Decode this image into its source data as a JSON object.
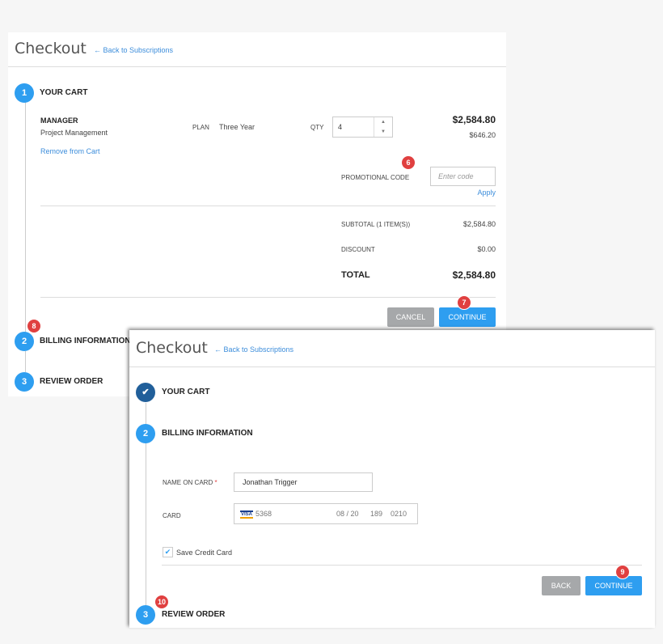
{
  "panel1": {
    "title": "Checkout",
    "back_link": "← Back to Subscriptions",
    "steps": [
      {
        "num": "1",
        "label": "YOUR CART"
      },
      {
        "num": "2",
        "label": "BILLING INFORMATION"
      },
      {
        "num": "3",
        "label": "REVIEW ORDER"
      }
    ],
    "item": {
      "name": "MANAGER",
      "subtitle": "Project Management",
      "remove": "Remove from Cart",
      "plan_label": "PLAN",
      "plan_value": "Three Year",
      "qty_label": "QTY",
      "qty_value": "4",
      "price": "$2,584.80",
      "unit_price": "$646.20"
    },
    "promo": {
      "label": "PROMOTIONAL CODE",
      "placeholder": "Enter code",
      "apply": "Apply"
    },
    "summary": {
      "subtotal_label": "SUBTOTAL (1 ITEM(S))",
      "subtotal_value": "$2,584.80",
      "discount_label": "DISCOUNT",
      "discount_value": "$0.00",
      "total_label": "TOTAL",
      "total_value": "$2,584.80"
    },
    "buttons": {
      "cancel": "CANCEL",
      "continue": "CONTINUE"
    }
  },
  "panel2": {
    "title": "Checkout",
    "back_link": "← Back to Subscriptions",
    "steps": [
      {
        "num": "✔",
        "label": "YOUR CART"
      },
      {
        "num": "2",
        "label": "BILLING INFORMATION"
      },
      {
        "num": "3",
        "label": "REVIEW ORDER"
      }
    ],
    "name_label": "NAME ON CARD",
    "required_mark": "*",
    "name_value": "Jonathan Trigger",
    "card_label": "CARD",
    "card": {
      "brand": "VISA",
      "number": "5368",
      "expiry": "08 / 20",
      "cvc": "189",
      "zip": "0210"
    },
    "save_card": "Save Credit Card",
    "buttons": {
      "back": "BACK",
      "continue": "CONTINUE"
    }
  },
  "badges": [
    "6",
    "7",
    "8",
    "9",
    "10"
  ],
  "colors": {
    "accent": "#2e9ef0",
    "done": "#215f9a",
    "badge": "#e04040",
    "link": "#3c8ddb"
  }
}
